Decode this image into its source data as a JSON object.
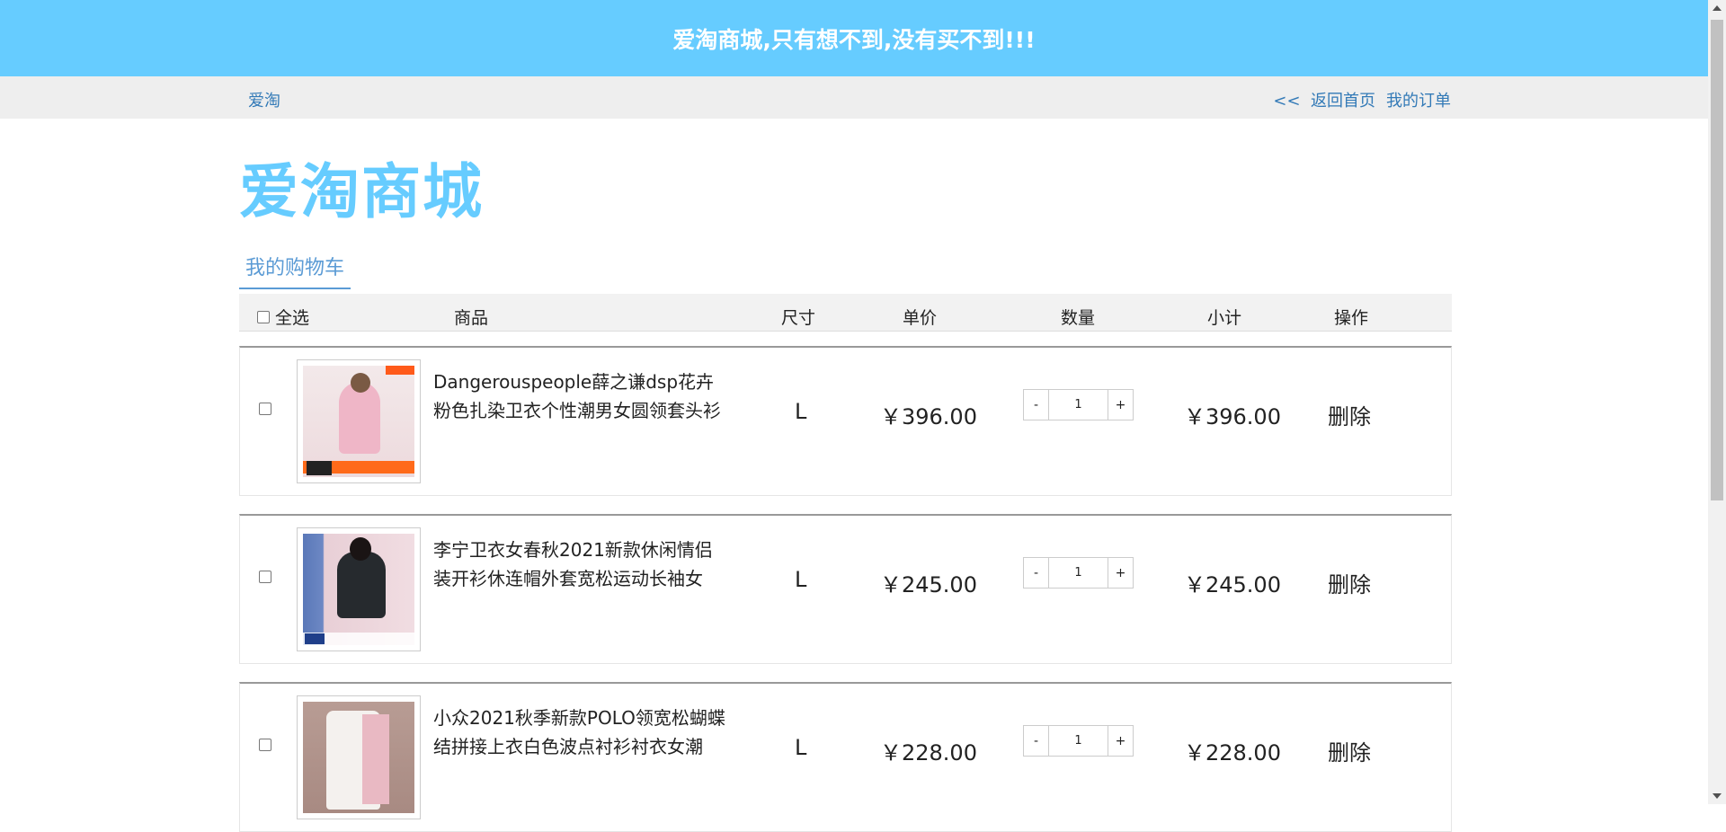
{
  "banner": {
    "text": "爱淘商城,只有想不到,没有买不到!!!"
  },
  "nav": {
    "brand": "爱淘",
    "back_home": "<<  返回首页",
    "my_orders": "我的订单"
  },
  "logo": {
    "text": "爱淘商城"
  },
  "cart_tab": {
    "label": "我的购物车"
  },
  "table": {
    "headers": {
      "select_all": "全选",
      "product": "商品",
      "size": "尺寸",
      "unit_price": "单价",
      "quantity": "数量",
      "subtotal": "小计",
      "action": "操作"
    },
    "rows": [
      {
        "name": "Dangerouspeople薛之谦dsp花卉粉色扎染卫衣个性潮男女圆领套头衫",
        "size": "L",
        "price": "￥396.00",
        "qty": "1",
        "subtotal": "￥396.00",
        "delete": "删除"
      },
      {
        "name": "李宁卫衣女春秋2021新款休闲情侣装开衫休连帽外套宽松运动长袖女",
        "size": "L",
        "price": "￥245.00",
        "qty": "1",
        "subtotal": "￥245.00",
        "delete": "删除"
      },
      {
        "name": "小众2021秋季新款POLO领宽松蝴蝶结拼接上衣白色波点衬衫衬衣女潮",
        "size": "L",
        "price": "￥228.00",
        "qty": "1",
        "subtotal": "￥228.00",
        "delete": "删除"
      }
    ],
    "qty_minus": "-",
    "qty_plus": "+"
  },
  "colors": {
    "banner_bg": "#66ccff",
    "logo": "#66ccff",
    "link": "#337ab7",
    "tab_accent": "#5b9bd5",
    "nav_bg": "#eeeeee"
  }
}
